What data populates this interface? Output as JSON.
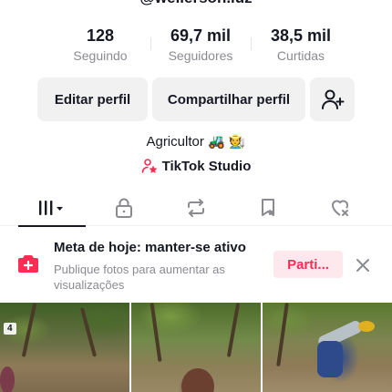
{
  "profile": {
    "username": "@wellerson.luz",
    "bio": "Agricultor 🚜 🧑‍🌾",
    "studio_link": "TikTok Studio"
  },
  "stats": [
    {
      "value": "128",
      "label": "Seguindo"
    },
    {
      "value": "69,7 mil",
      "label": "Seguidores"
    },
    {
      "value": "38,5 mil",
      "label": "Curtidas"
    }
  ],
  "actions": {
    "edit_label": "Editar perfil",
    "share_label": "Compartilhar perfil",
    "add_friend_icon": "add-user-icon"
  },
  "tabs": [
    {
      "name": "videos",
      "icon": "grid-icon",
      "active": true
    },
    {
      "name": "private",
      "icon": "lock-icon",
      "active": false
    },
    {
      "name": "reposts",
      "icon": "repost-icon",
      "active": false
    },
    {
      "name": "favorites",
      "icon": "bookmark-icon",
      "active": false
    },
    {
      "name": "liked",
      "icon": "heart-icon",
      "active": false
    }
  ],
  "goal": {
    "title": "Meta de hoje: manter-se ativo",
    "subtitle": "Publique fotos para aumentar as visualizações",
    "button_label": "Parti...",
    "accent": "#fe2c55"
  },
  "grid": {
    "badge": "4"
  }
}
